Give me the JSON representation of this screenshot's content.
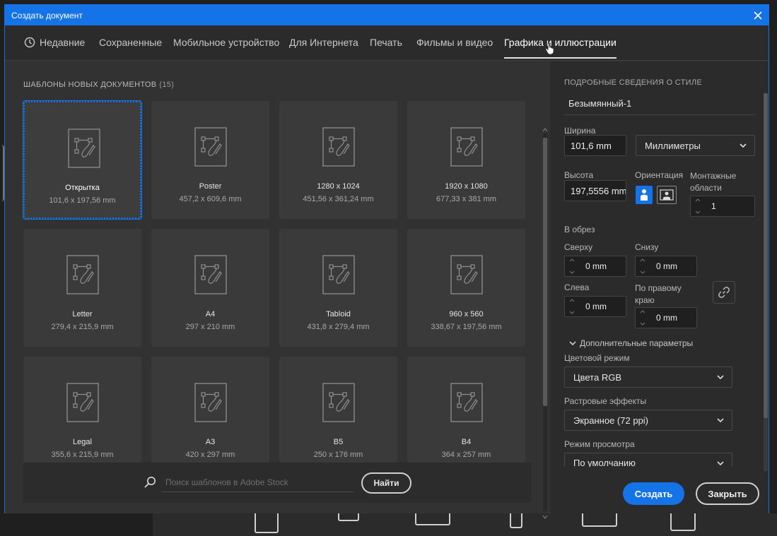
{
  "dialog": {
    "title": "Создать документ"
  },
  "tabs": [
    {
      "label": "Недавние"
    },
    {
      "label": "Сохраненные"
    },
    {
      "label": "Мобильное устройство"
    },
    {
      "label": "Для Интернета"
    },
    {
      "label": "Печать"
    },
    {
      "label": "Фильмы и видео"
    },
    {
      "label": "Графика и иллюстрации"
    }
  ],
  "active_tab": "Графика и иллюстрации",
  "templates": {
    "heading": "ШАБЛОНЫ НОВЫХ ДОКУМЕНТОВ",
    "count": "(15)",
    "items": [
      {
        "name": "Открытка",
        "size": "101,6 x 197,56 mm"
      },
      {
        "name": "Poster",
        "size": "457,2 x 609,6 mm"
      },
      {
        "name": "1280 x 1024",
        "size": "451,56 x 361,24 mm"
      },
      {
        "name": "1920 x 1080",
        "size": "677,33 x 381 mm"
      },
      {
        "name": "Letter",
        "size": "279,4 x 215,9 mm"
      },
      {
        "name": "A4",
        "size": "297 x 210 mm"
      },
      {
        "name": "Tabloid",
        "size": "431,8 x 279,4 mm"
      },
      {
        "name": "960 x 560",
        "size": "338,67 x 197,56 mm"
      },
      {
        "name": "Legal",
        "size": "355,6 x 215,9 mm"
      },
      {
        "name": "A3",
        "size": "420 x 297 mm"
      },
      {
        "name": "B5",
        "size": "250 x 176 mm"
      },
      {
        "name": "B4",
        "size": "364 x 257 mm"
      }
    ]
  },
  "search": {
    "placeholder": "Поиск шаблонов в Adobe Stock",
    "button": "Найти"
  },
  "details": {
    "heading": "ПОДРОБНЫЕ СВЕДЕНИЯ О СТИЛЕ",
    "doc_name": "Безымянный-1",
    "width_label": "Ширина",
    "width_value": "101,6 mm",
    "units": "Миллиметры",
    "height_label": "Высота",
    "height_value": "197,5556 mm",
    "orientation_label": "Ориентация",
    "artboards_label_1": "Монтажные",
    "artboards_label_2": "области",
    "artboards_value": "1",
    "bleed_label": "В обрез",
    "top_label": "Сверху",
    "top_value": "0 mm",
    "bottom_label": "Снизу",
    "bottom_value": "0 mm",
    "left_label": "Слева",
    "left_value": "0 mm",
    "right_label_1": "По правому",
    "right_label_2": "краю",
    "right_value": "0 mm",
    "more_label": "Дополнительные параметры",
    "color_mode_label": "Цветовой режим",
    "color_mode_value": "Цвета RGB",
    "raster_label": "Растровые эффекты",
    "raster_value": "Экранное (72 ppi)",
    "preview_label": "Режим просмотра",
    "preview_value": "По умолчанию",
    "create_button": "Создать",
    "close_button": "Закрыть"
  },
  "colors": {
    "accent": "#1473e6",
    "dialog_bg": "#323232",
    "panel_bg": "#2b2b2b",
    "card_bg": "#3a3a3a"
  }
}
